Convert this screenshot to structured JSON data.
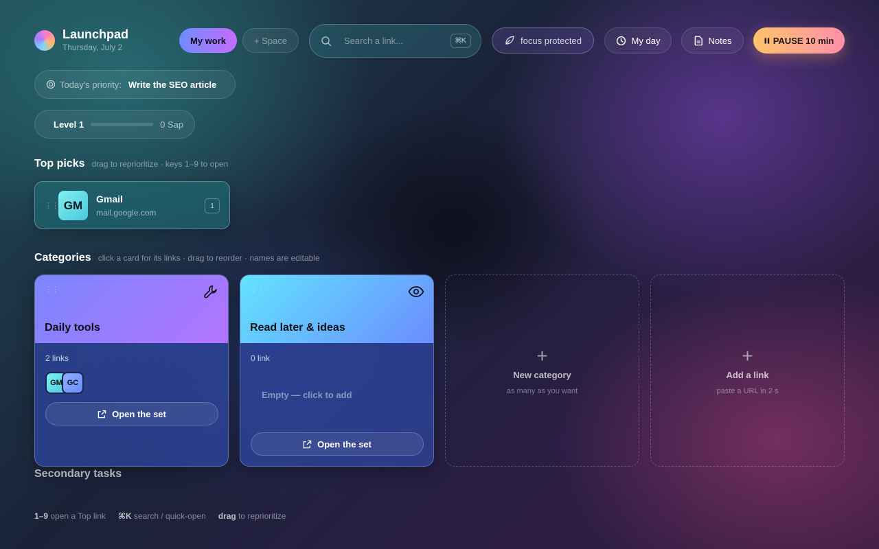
{
  "brand": {
    "title": "Launchpad",
    "date": "Thursday, July 2"
  },
  "header": {
    "my_work": "My work",
    "space": "+ Space",
    "search_placeholder": "Search a link...",
    "search_shortcut": "⌘K",
    "focus": "focus protected",
    "my_day": "My day",
    "notes": "Notes",
    "pause": "PAUSE 10 min"
  },
  "priority": {
    "label": "Today's priority:",
    "value": "Write the SEO article"
  },
  "level": {
    "label": "Level 1",
    "xp": "0 Sap",
    "progress": 0
  },
  "top_picks": {
    "title": "Top picks",
    "hint": "drag to reprioritize · keys 1–9 to open",
    "items": [
      {
        "initials": "GM",
        "name": "Gmail",
        "url": "mail.google.com",
        "key": "1"
      }
    ]
  },
  "categories": {
    "title": "Categories",
    "hint": "click a card for its links · drag to reorder · names are editable",
    "cards": [
      {
        "title": "Daily tools",
        "icon": "wrench-icon",
        "count": "2 links",
        "avatars": [
          "GM",
          "GC"
        ],
        "open": "Open the set"
      },
      {
        "title": "Read later & ideas",
        "icon": "eye-icon",
        "count": "0 link",
        "empty": "Empty — click to add",
        "open": "Open the set"
      }
    ],
    "new_category": {
      "title": "New category",
      "sub": "as many as you want"
    },
    "add_link": {
      "title": "Add a link",
      "sub": "paste a URL in 2 s"
    }
  },
  "secondary": {
    "title": "Secondary tasks"
  },
  "footer": {
    "h1_key": "1–9",
    "h1_text": " open a Top link",
    "h2_key": "⌘K",
    "h2_text": " search / quick-open",
    "h3_key": "drag",
    "h3_text": " to reprioritize"
  },
  "colors": {
    "accent": "#a77bff",
    "pause": "#ffc36b",
    "teal": "#4cc8e0"
  }
}
